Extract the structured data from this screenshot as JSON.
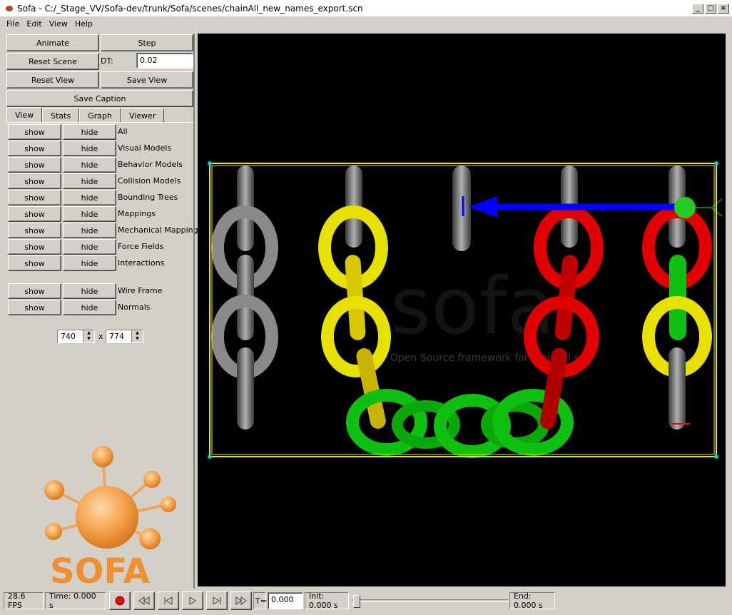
{
  "window": {
    "title": "Sofa - C:/_Stage_VV/Sofa-dev/trunk/Sofa/scenes/chainAll_new_names_export.scn"
  },
  "menu": [
    "File",
    "Edit",
    "View",
    "Help"
  ],
  "controls": {
    "animate": "Animate",
    "step": "Step",
    "reset_scene": "Reset Scene",
    "dt_label": "DT:",
    "dt_value": "0.02",
    "reset_view": "Reset View",
    "save_view": "Save View",
    "save_caption": "Save Caption"
  },
  "tabs": [
    "View",
    "Stats",
    "Graph",
    "Viewer"
  ],
  "view_rows": [
    {
      "show": "show",
      "hide": "hide",
      "label": "All"
    },
    {
      "show": "show",
      "hide": "hide",
      "label": "Visual Models"
    },
    {
      "show": "show",
      "hide": "hide",
      "label": "Behavior Models"
    },
    {
      "show": "show",
      "hide": "hide",
      "label": "Collision Models"
    },
    {
      "show": "show",
      "hide": "hide",
      "label": "Bounding Trees"
    },
    {
      "show": "show",
      "hide": "hide",
      "label": "Mappings"
    },
    {
      "show": "show",
      "hide": "hide",
      "label": "Mechanical Mappings"
    },
    {
      "show": "show",
      "hide": "hide",
      "label": "Force Fields"
    },
    {
      "show": "show",
      "hide": "hide",
      "label": "Interactions"
    },
    {
      "show": "show",
      "hide": "hide",
      "label": "Wire Frame"
    },
    {
      "show": "show",
      "hide": "hide",
      "label": "Normals"
    }
  ],
  "size": {
    "width": "740",
    "sep": "x",
    "height": "774"
  },
  "logo": {
    "text": "SOFA"
  },
  "viewport": {
    "watermark": "sofa",
    "watermark_caption": "Open Source framework for medical s"
  },
  "status": {
    "fps": "28.6 FPS",
    "time": "Time: 0.000 s",
    "t_label": "T=",
    "t_value": "0.000",
    "init": "Init: 0.000 s",
    "end": "End: 0.000 s",
    "progress": 0
  },
  "icons": {
    "record": "record-icon",
    "rewind": "rewind-icon",
    "step_back": "step-back-icon",
    "play": "play-icon",
    "step_forward": "step-forward-icon",
    "fast_forward": "fast-forward-icon"
  }
}
